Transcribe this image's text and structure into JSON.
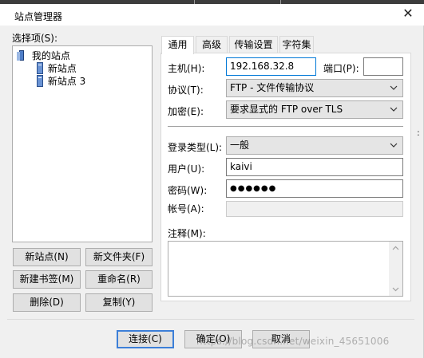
{
  "window": {
    "title": "站点管理器",
    "close_symbol": "✕"
  },
  "sites": {
    "label": "选择项(S):",
    "tree": {
      "root": "我的站点",
      "items": [
        "新站点",
        "新站点 3"
      ]
    },
    "buttons": {
      "new_site": "新站点(N)",
      "new_folder": "新文件夹(F)",
      "new_bookmark": "新建书签(M)",
      "rename": "重命名(R)",
      "delete": "删除(D)",
      "copy": "复制(Y)"
    }
  },
  "tabs": [
    "通用",
    "高级",
    "传输设置",
    "字符集"
  ],
  "general": {
    "host_label": "主机(H):",
    "host_value": "192.168.32.8",
    "port_label": "端口(P):",
    "port_value": "",
    "protocol_label": "协议(T):",
    "protocol_value": "FTP - 文件传输协议",
    "encryption_label": "加密(E):",
    "encryption_value": "要求显式的 FTP over TLS",
    "logon_type_label": "登录类型(L):",
    "logon_type_value": "一般",
    "user_label": "用户(U):",
    "user_value": "kaivi",
    "password_label": "密码(W):",
    "password_value": "●●●●●●",
    "account_label": "帐号(A):",
    "account_value": "",
    "comments_label": "注释(M):",
    "comments_value": ""
  },
  "footer": {
    "connect": "连接(C)",
    "ok": "确定(O)",
    "cancel": "取消"
  },
  "watermark": "https://blog.csdn.net/weixin_45651006",
  "colors": {
    "focus_border": "#0078d7",
    "default_button_border": "#3c7fd8",
    "dialog_bg": "#f0f0f0"
  }
}
